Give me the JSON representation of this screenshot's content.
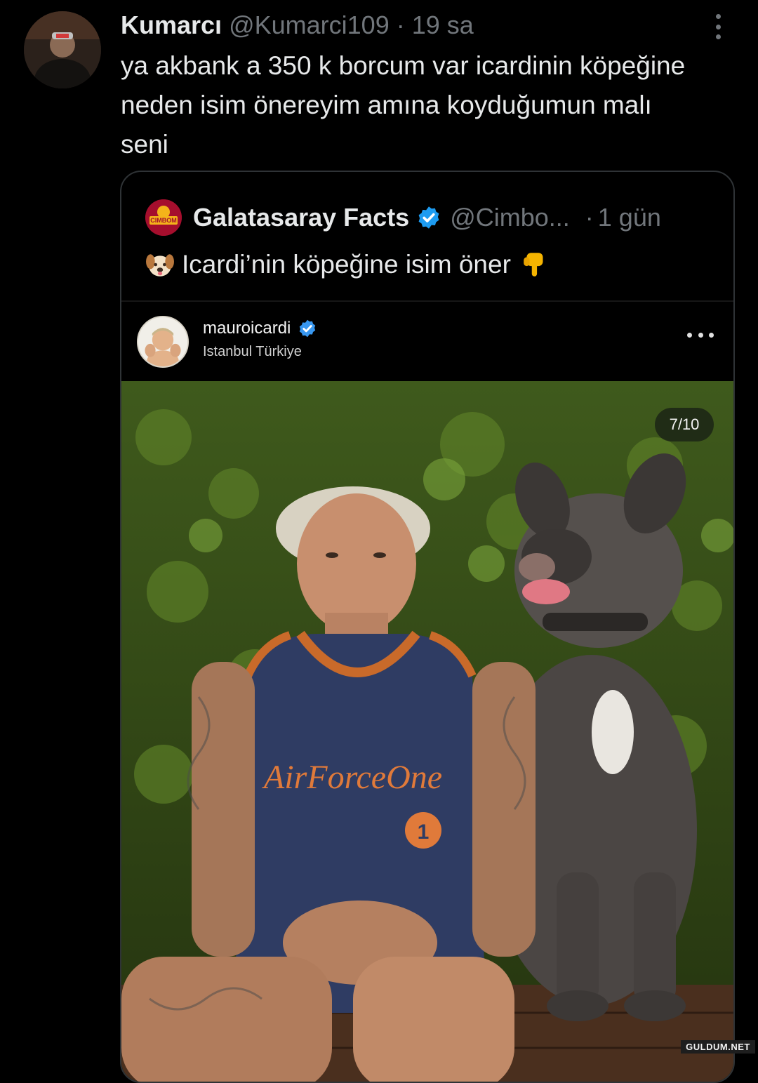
{
  "tweet": {
    "author_name": "Kumarcı",
    "author_handle": "@Kumarci109",
    "separator": "·",
    "time": "19 sa",
    "text": "ya akbank a 350 k borcum var icardinin köpeğine neden isim önereyim amına koyduğumun malı seni"
  },
  "quote": {
    "author_name": "Galatasaray Facts",
    "author_handle": "@Cimbo...",
    "separator": "·",
    "time": "1 gün",
    "text": "Icardi’nin köpeğine isim öner",
    "logo_text": "CIMBOM",
    "embed": {
      "username": "mauroicardi",
      "location": "Istanbul Türkiye",
      "image_counter": "7/10",
      "jersey_text": "AirForceOne",
      "jersey_number": "1"
    }
  },
  "watermark": "GULDUM.NET",
  "colors": {
    "background": "#000000",
    "text_primary": "#e7e9ea",
    "text_secondary": "#71767b",
    "border": "#2f3336",
    "verified_blue": "#1d9bf0"
  },
  "icons": [
    "more-vertical-icon",
    "verified-badge-icon",
    "dog-face-emoji",
    "pointing-down-emoji",
    "more-horizontal-icon"
  ]
}
